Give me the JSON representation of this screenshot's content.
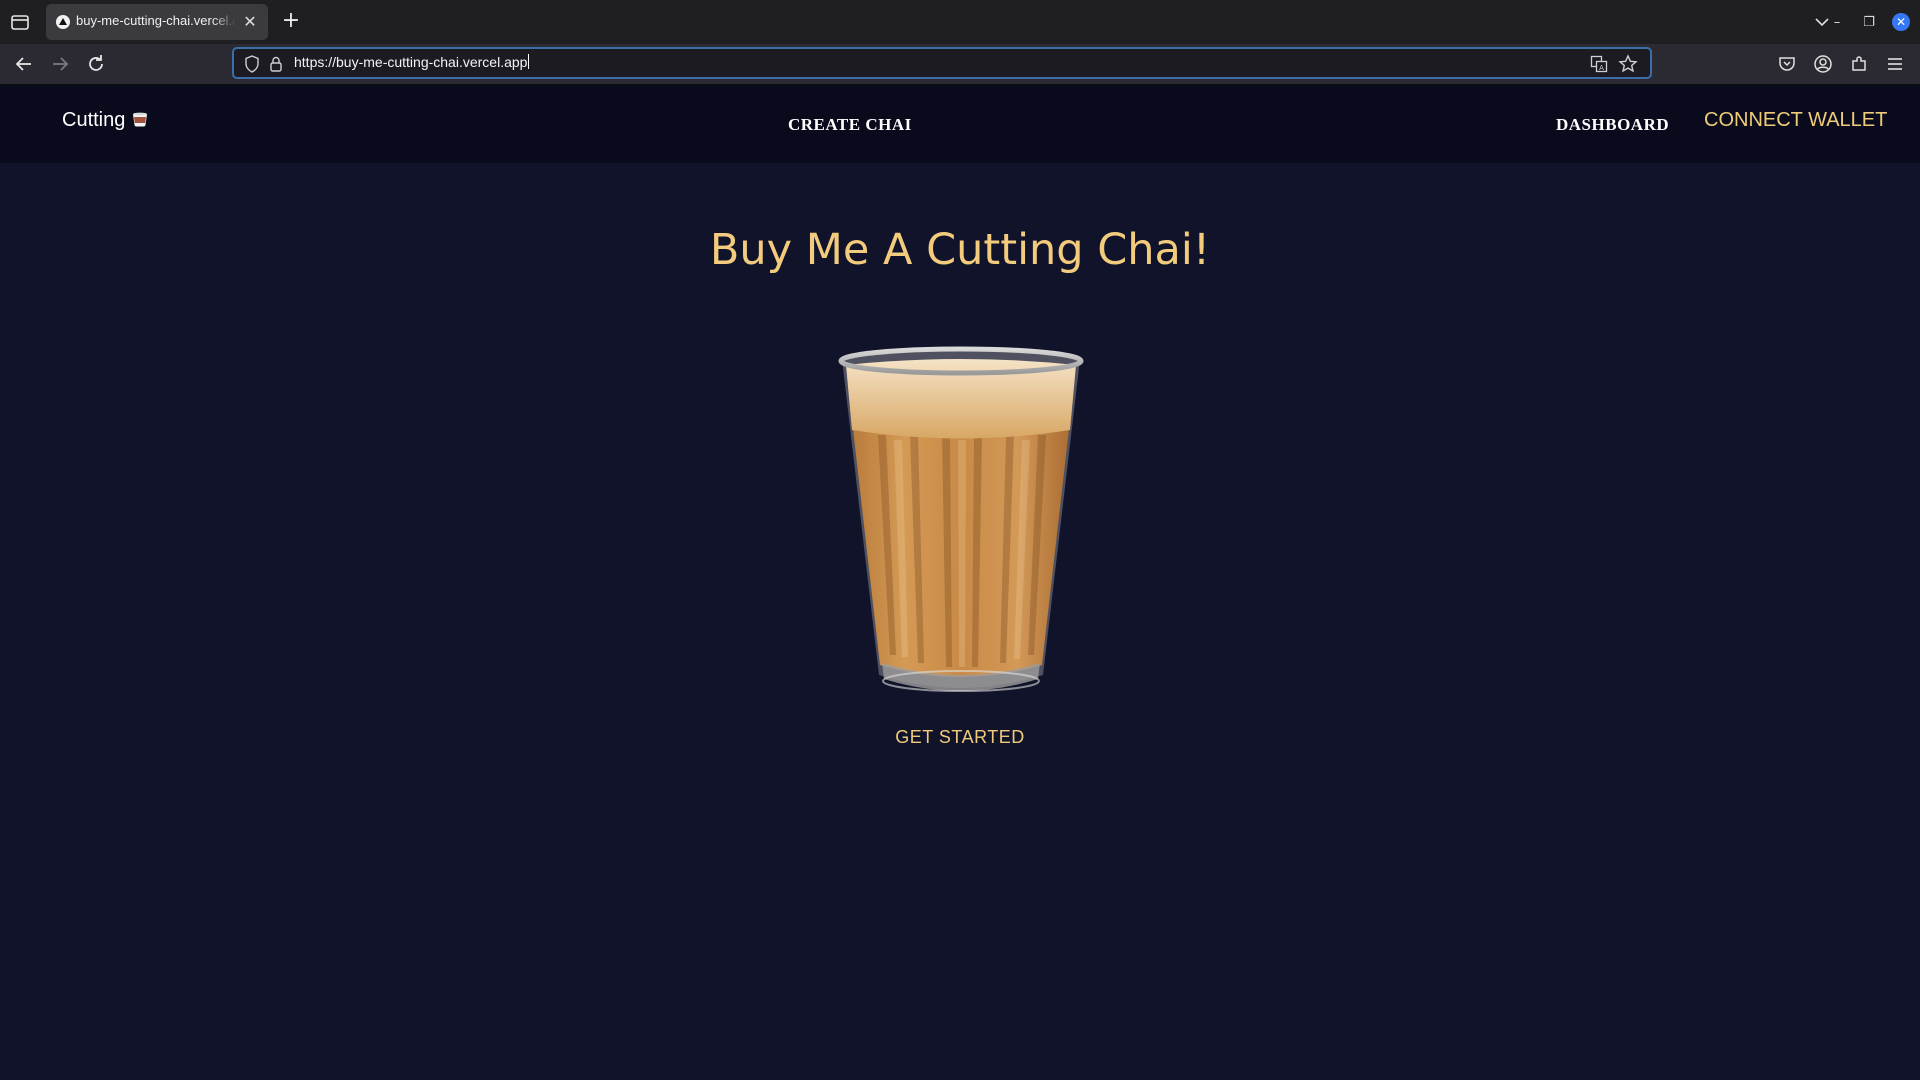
{
  "browser": {
    "tab_title": "buy-me-cutting-chai.vercel.app",
    "url": "https://buy-me-cutting-chai.vercel.app"
  },
  "site": {
    "brand": "Cutting",
    "brand_icon": "teacup-icon",
    "nav": {
      "create": "CREATE CHAI",
      "dashboard": "DASHBOARD",
      "connect_wallet": "CONNECT WALLET"
    },
    "hero_title": "Buy Me A Cutting Chai!",
    "hero_image": "cutting-chai-glass",
    "cta": "GET STARTED"
  },
  "colors": {
    "page_bg": "#11132a",
    "header_bg": "#090b1c",
    "accent": "#f0cc7a"
  }
}
